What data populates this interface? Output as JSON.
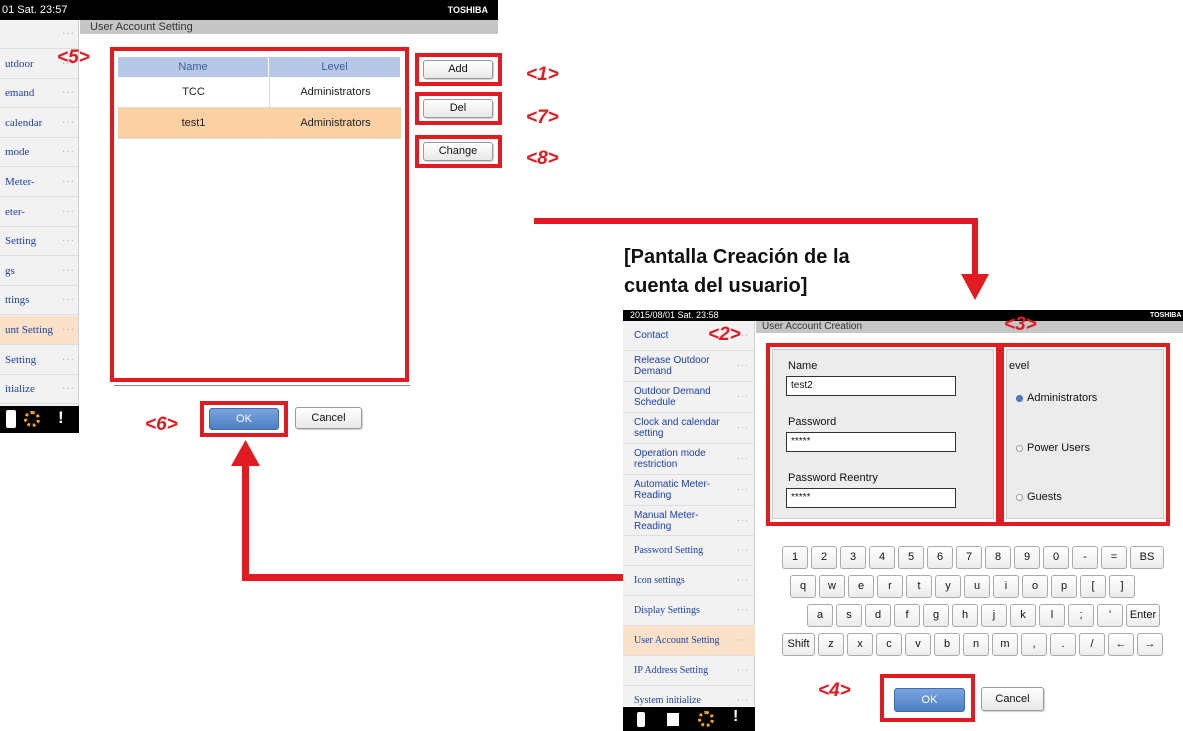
{
  "left_screen": {
    "datetime": "01 Sat. 23:57",
    "brand": "TOSHIBA",
    "title": "User Account Setting",
    "sidebar": [
      {
        "label": "",
        "active": false
      },
      {
        "label": "utdoor",
        "active": false
      },
      {
        "label": "emand",
        "active": false
      },
      {
        "label": "calendar",
        "active": false
      },
      {
        "label": "mode",
        "active": false
      },
      {
        "label": "Meter-",
        "active": false
      },
      {
        "label": "eter-",
        "active": false
      },
      {
        "label": "Setting",
        "active": false
      },
      {
        "label": "gs",
        "active": false
      },
      {
        "label": "ttings",
        "active": false
      },
      {
        "label": "unt Setting",
        "active": true
      },
      {
        "label": "Setting",
        "active": false
      },
      {
        "label": "itialize",
        "active": false
      }
    ],
    "table": {
      "headers": [
        "Name",
        "Level"
      ],
      "rows": [
        {
          "name": "TCC",
          "level": "Administrators",
          "selected": false
        },
        {
          "name": "test1",
          "level": "Administrators",
          "selected": true
        }
      ]
    },
    "buttons": {
      "add": "Add",
      "del": "Del",
      "change": "Change",
      "ok": "OK",
      "cancel": "Cancel"
    }
  },
  "callouts": {
    "c1": "<1>",
    "c2": "<2>",
    "c3": "<3>",
    "c4": "<4>",
    "c5": "<5>",
    "c6": "<6>",
    "c7": "<7>",
    "c8": "<8>"
  },
  "heading": {
    "line1": "[Pantalla Creación de la",
    "line2": "cuenta del usuario]"
  },
  "right_screen": {
    "datetime": "2015/08/01  Sat.  23:58",
    "brand": "TOSHIBA",
    "title": "User Account Creation",
    "sidebar": [
      {
        "label": "Contact",
        "active": false
      },
      {
        "label": "Release Outdoor Demand",
        "active": false
      },
      {
        "label": "Outdoor Demand Schedule",
        "active": false
      },
      {
        "label": "Clock and calendar setting",
        "active": false
      },
      {
        "label": "Operation mode restriction",
        "active": false
      },
      {
        "label": "Automatic Meter-Reading",
        "active": false
      },
      {
        "label": "Manual Meter-Reading",
        "active": false
      },
      {
        "label": "Password Setting",
        "active": false
      },
      {
        "label": "Icon settings",
        "active": false
      },
      {
        "label": "Display Settings",
        "active": false
      },
      {
        "label": "User Account Setting",
        "active": true
      },
      {
        "label": "IP Address Setting",
        "active": false
      },
      {
        "label": "System initialize",
        "active": false
      }
    ],
    "form": {
      "name_label": "Name",
      "name_value": "test2",
      "password_label": "Password",
      "password_value": "*****",
      "reentry_label": "Password Reentry",
      "reentry_value": "*****"
    },
    "level": {
      "label": "evel",
      "options": [
        {
          "label": "Administrators",
          "selected": true
        },
        {
          "label": "Power Users",
          "selected": false
        },
        {
          "label": "Guests",
          "selected": false
        }
      ]
    },
    "keyboard": {
      "row1": [
        "1",
        "2",
        "3",
        "4",
        "5",
        "6",
        "7",
        "8",
        "9",
        "0",
        "-",
        "=",
        "BS"
      ],
      "row2": [
        "q",
        "w",
        "e",
        "r",
        "t",
        "y",
        "u",
        "i",
        "o",
        "p",
        "[",
        "]"
      ],
      "row3": [
        "a",
        "s",
        "d",
        "f",
        "g",
        "h",
        "j",
        "k",
        "l",
        ";",
        "'",
        "Enter"
      ],
      "row4": [
        "Shift",
        "z",
        "x",
        "c",
        "v",
        "b",
        "n",
        "m",
        ",",
        ".",
        "/",
        "←",
        "→"
      ]
    },
    "buttons": {
      "ok": "OK",
      "cancel": "Cancel"
    }
  }
}
